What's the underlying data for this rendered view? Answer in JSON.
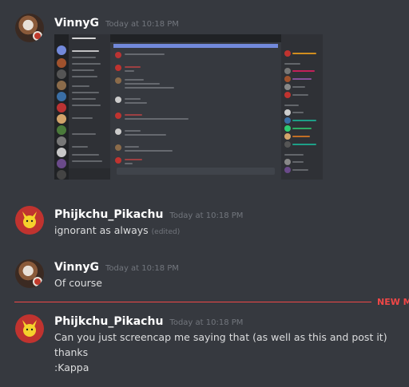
{
  "messages": [
    {
      "username": "VinnyG",
      "timestamp": "Today at 10:18 PM",
      "avatar": "vinny-avatar"
    },
    {
      "username": "Phijkchu_Pikachu",
      "timestamp": "Today at 10:18 PM",
      "text": "ignorant as always",
      "edited": "(edited)",
      "avatar": "pikachu-avatar"
    },
    {
      "username": "VinnyG",
      "timestamp": "Today at 10:18 PM",
      "text": "Of course",
      "avatar": "vinny-avatar"
    },
    {
      "username": "Phijkchu_Pikachu",
      "timestamp": "Today at 10:18 PM",
      "lines": [
        "Can you just screencap me saying that (as well as this and post it)",
        "thanks",
        ":Kappa"
      ],
      "avatar": "pikachu-avatar"
    }
  ],
  "new_messages_label": "NEW M",
  "colors": {
    "background": "#36393f",
    "username": "#ffffff",
    "timestamp": "#72767d",
    "new_divider": "#f04747",
    "text": "#dcddde"
  }
}
